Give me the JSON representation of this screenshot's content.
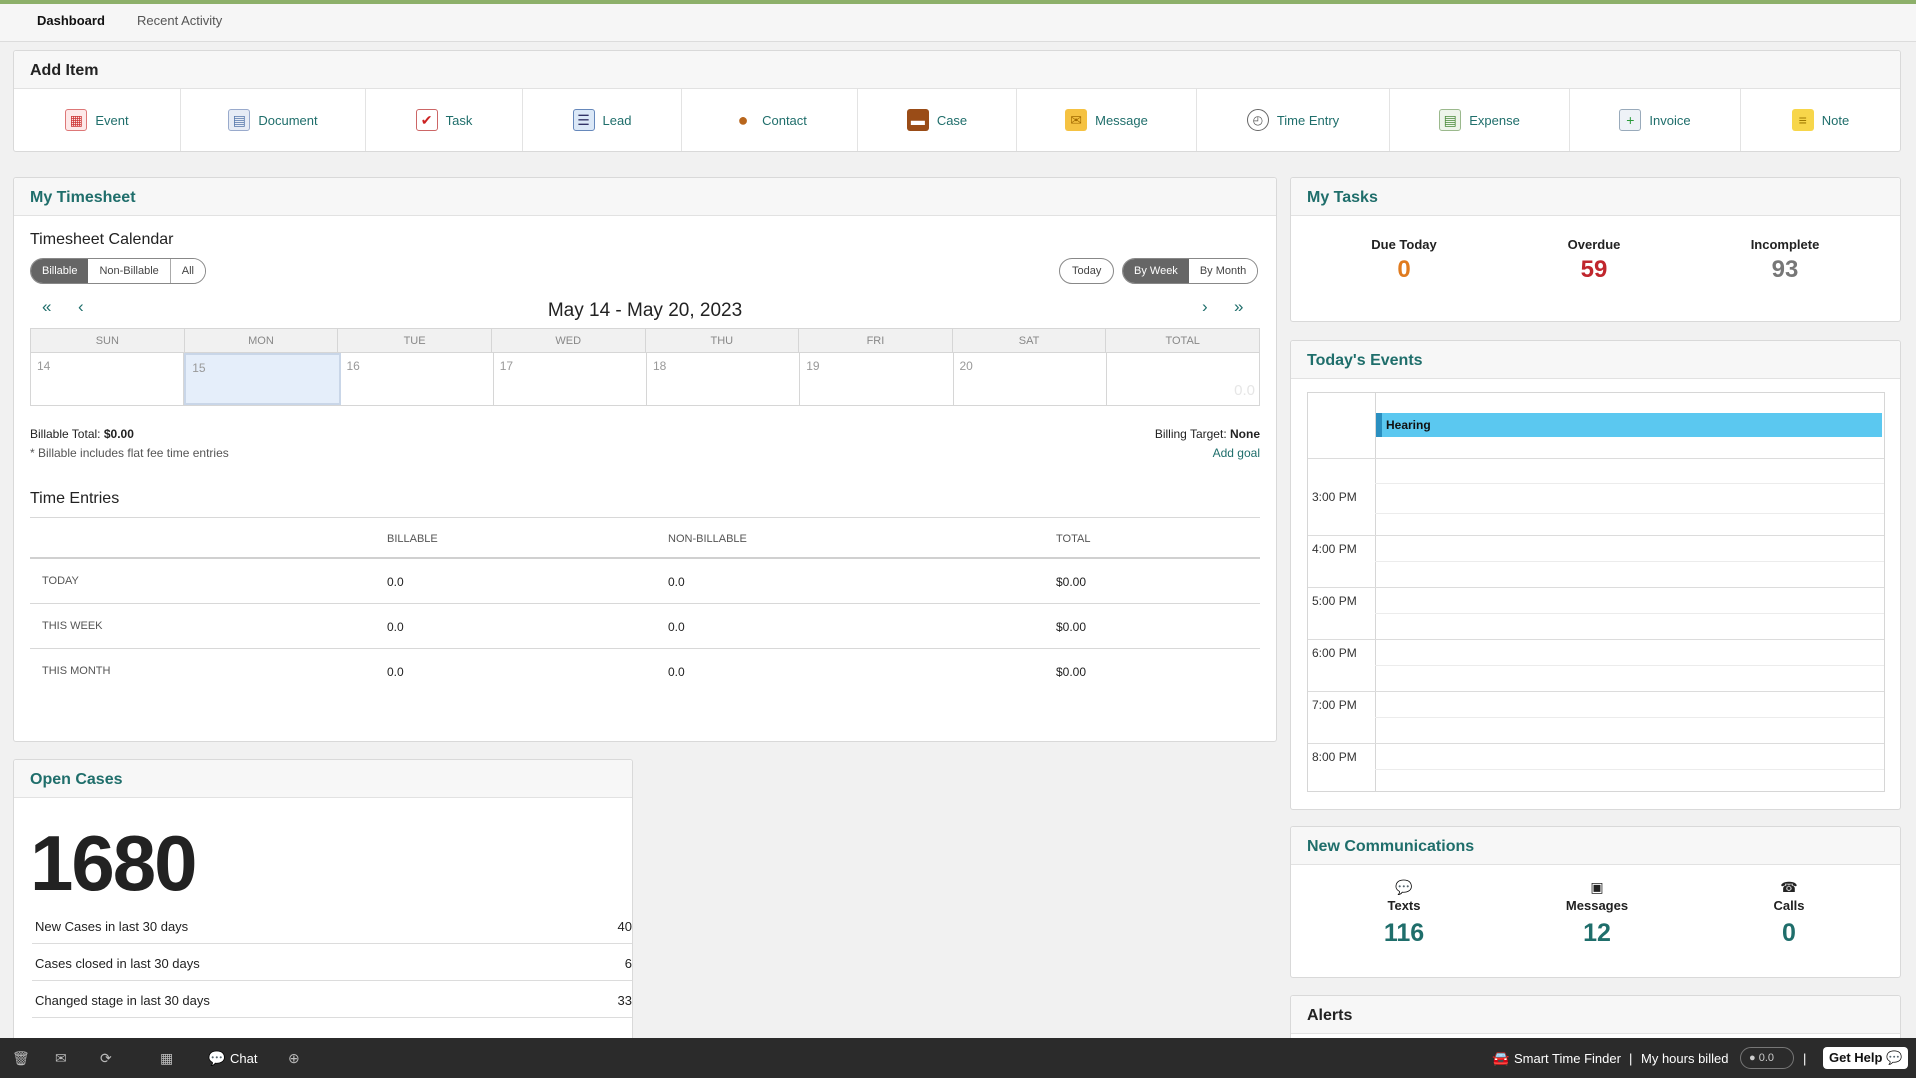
{
  "tabs": [
    "Dashboard",
    "Recent Activity"
  ],
  "add_item": {
    "title": "Add Item",
    "items": [
      {
        "label": "Event",
        "icon": "calendar-icon"
      },
      {
        "label": "Document",
        "icon": "document-icon"
      },
      {
        "label": "Task",
        "icon": "task-icon"
      },
      {
        "label": "Lead",
        "icon": "lead-icon"
      },
      {
        "label": "Contact",
        "icon": "contact-icon"
      },
      {
        "label": "Case",
        "icon": "briefcase-icon"
      },
      {
        "label": "Message",
        "icon": "envelope-icon"
      },
      {
        "label": "Time Entry",
        "icon": "clock-icon"
      },
      {
        "label": "Expense",
        "icon": "expense-icon"
      },
      {
        "label": "Invoice",
        "icon": "invoice-icon"
      },
      {
        "label": "Note",
        "icon": "note-icon"
      }
    ]
  },
  "timesheet": {
    "title": "My Timesheet",
    "calendar_title": "Timesheet Calendar",
    "filters": [
      "Billable",
      "Non-Billable",
      "All"
    ],
    "today_btn": "Today",
    "views": [
      "By Week",
      "By Month"
    ],
    "range": "May 14 - May 20, 2023",
    "days": [
      "SUN",
      "MON",
      "TUE",
      "WED",
      "THU",
      "FRI",
      "SAT",
      "TOTAL"
    ],
    "dates": [
      "14",
      "15",
      "16",
      "17",
      "18",
      "19",
      "20",
      ""
    ],
    "total_value": "0.0",
    "billable_total_label": "Billable Total:",
    "billable_total_value": "$0.00",
    "billable_note": "* Billable includes flat fee time entries",
    "billing_target_label": "Billing Target:",
    "billing_target_value": "None",
    "add_goal": "Add goal",
    "time_entries_title": "Time Entries",
    "te_headers": [
      "BILLABLE",
      "NON-BILLABLE",
      "TOTAL"
    ],
    "te_rows": [
      {
        "label": "TODAY",
        "billable": "0.0",
        "nonbillable": "0.0",
        "total": "$0.00"
      },
      {
        "label": "THIS WEEK",
        "billable": "0.0",
        "nonbillable": "0.0",
        "total": "$0.00"
      },
      {
        "label": "THIS MONTH",
        "billable": "0.0",
        "nonbillable": "0.0",
        "total": "$0.00"
      }
    ]
  },
  "tasks": {
    "title": "My Tasks",
    "due_label": "Due Today",
    "due_value": "0",
    "overdue_label": "Overdue",
    "overdue_value": "59",
    "incomplete_label": "Incomplete",
    "incomplete_value": "93"
  },
  "events": {
    "title": "Today's Events",
    "event_label": "Hearing",
    "times": [
      "3:00 PM",
      "4:00 PM",
      "5:00 PM",
      "6:00 PM",
      "7:00 PM",
      "8:00 PM"
    ]
  },
  "open_cases": {
    "title": "Open Cases",
    "count": "1680",
    "rows": [
      {
        "label": "New Cases in last 30 days",
        "value": "40"
      },
      {
        "label": "Cases closed in last 30 days",
        "value": "6"
      },
      {
        "label": "Changed stage in last 30 days",
        "value": "33"
      }
    ]
  },
  "communications": {
    "title": "New Communications",
    "texts_label": "Texts",
    "texts_value": "116",
    "messages_label": "Messages",
    "messages_value": "12",
    "calls_label": "Calls",
    "calls_value": "0"
  },
  "alerts": {
    "title": "Alerts"
  },
  "footer": {
    "chat": "Chat",
    "smart_time_finder": "Smart Time Finder",
    "sep1": "|",
    "hours_billed": "My hours billed",
    "hours_value": "0.0",
    "sep2": "|",
    "get_help": "Get Help"
  },
  "colors": {
    "accent": "#1f6e6b",
    "overdue": "#c0262d",
    "due": "#e07b1f",
    "event": "#5bc8f0"
  }
}
